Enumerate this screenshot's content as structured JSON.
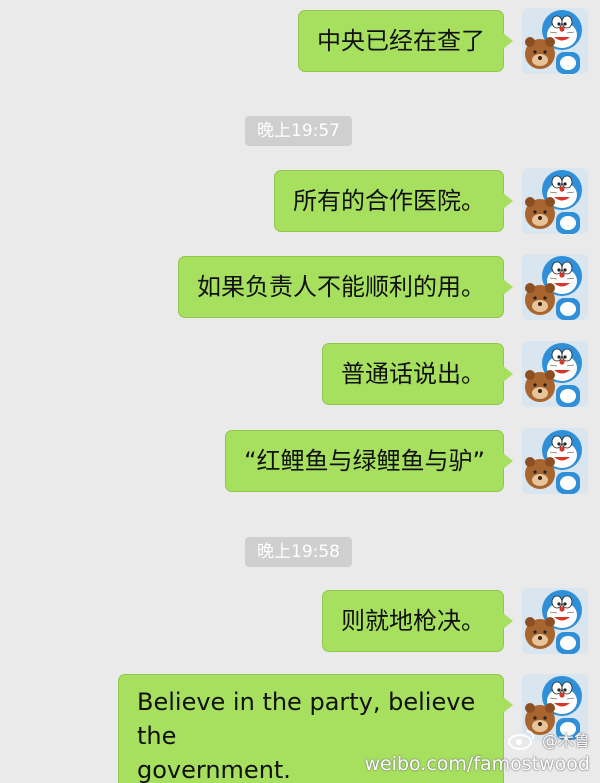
{
  "chat": {
    "messages": [
      {
        "text": "中央已经在查了"
      },
      {
        "timestamp": "晚上19:57"
      },
      {
        "text": "所有的合作医院。"
      },
      {
        "text": "如果负责人不能顺利的用。"
      },
      {
        "text": "普通话说出。"
      },
      {
        "text": "“红鲤鱼与绿鲤鱼与驴”"
      },
      {
        "timestamp": "晚上19:58"
      },
      {
        "text": "则就地枪决。"
      },
      {
        "text_line1": "Believe in the party, believe the",
        "text_line2": "government."
      }
    ]
  },
  "avatar": {
    "icon": "doraemon-avatar-icon"
  },
  "colors": {
    "background": "#eaeaea",
    "bubble": "#a6e05e",
    "timestamp_bg": "#cfcfcf"
  },
  "watermark": {
    "handle": "@木鲁",
    "site": "weibo.com/famostwood"
  }
}
